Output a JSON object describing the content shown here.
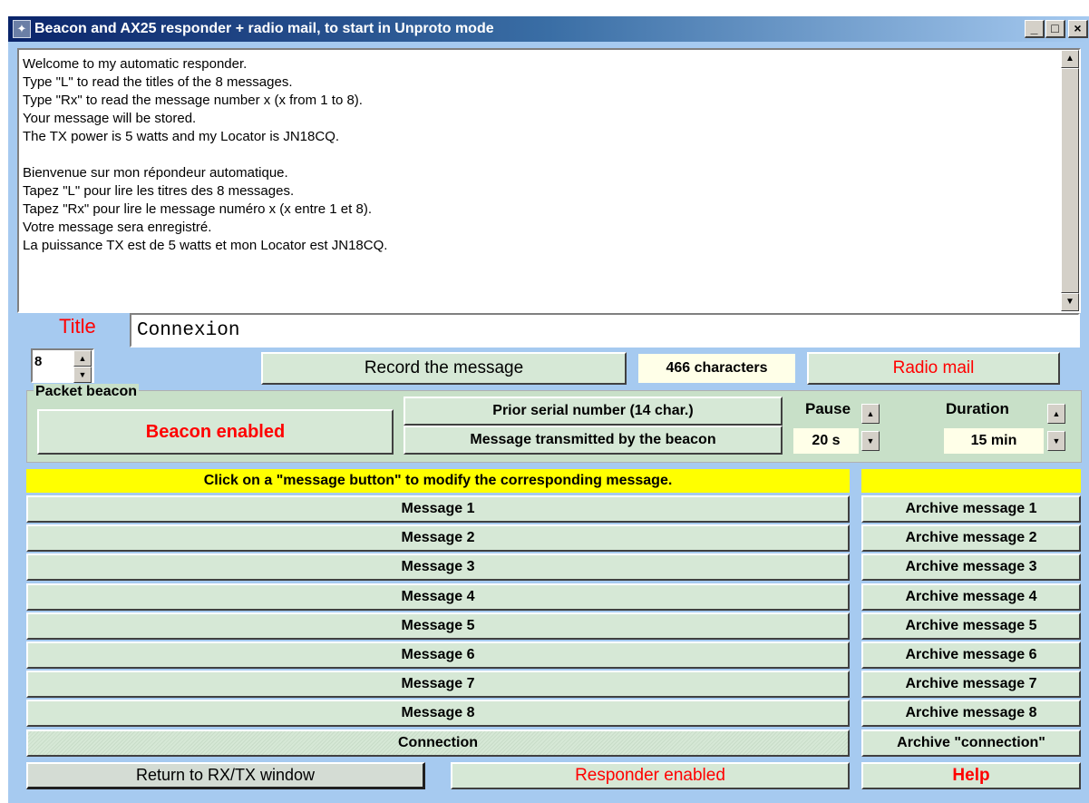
{
  "window": {
    "title": "Beacon and AX25 responder + radio mail, to start in Unproto mode",
    "controls": {
      "minimize": "_",
      "maximize": "□",
      "close": "×"
    }
  },
  "message_text": [
    "Welcome to my automatic responder.",
    "Type \"L\" to read the titles of the 8 messages.",
    "Type \"Rx\" to read the message number x (x from 1 to 8).",
    "Your message will be stored.",
    "The TX power is 5 watts and my Locator is JN18CQ.",
    "",
    "Bienvenue sur mon répondeur automatique.",
    "Tapez \"L\" pour lire les titres des 8 messages.",
    "Tapez \"Rx\" pour lire le message numéro x (x entre 1 et 8).",
    "Votre message sera enregistré.",
    "La puissance TX est de 5 watts et mon Locator est JN18CQ."
  ],
  "title_field": {
    "label": "Title",
    "value": "Connexion"
  },
  "message_number": "8",
  "record_button": "Record the message",
  "char_count": "466 characters",
  "radio_mail_button": "Radio mail",
  "beacon": {
    "group_label": "Packet beacon",
    "enabled_button": "Beacon enabled",
    "prior_serial_button": "Prior serial number (14 char.)",
    "message_transmitted_button": "Message transmitted by the beacon",
    "pause_label": "Pause",
    "pause_value": "20 s",
    "duration_label": "Duration",
    "duration_value": "15 min"
  },
  "instruction": "Click on a \"message button\" to modify the corresponding message.",
  "messages": [
    "Message 1",
    "Message 2",
    "Message 3",
    "Message 4",
    "Message 5",
    "Message 6",
    "Message 7",
    "Message 8",
    "Connection"
  ],
  "archives": [
    "Archive message 1",
    "Archive message 2",
    "Archive message 3",
    "Archive message 4",
    "Archive message 5",
    "Archive message 6",
    "Archive message 7",
    "Archive message 8",
    "Archive \"connection\""
  ],
  "bottom": {
    "return_button": "Return to RX/TX window",
    "responder_button": "Responder enabled",
    "help_button": "Help"
  },
  "colors": {
    "window_bg": "#a6caf0",
    "button_face": "#d6e8d6",
    "highlight_bar": "#ffff00",
    "alert_text": "#ff0000"
  }
}
